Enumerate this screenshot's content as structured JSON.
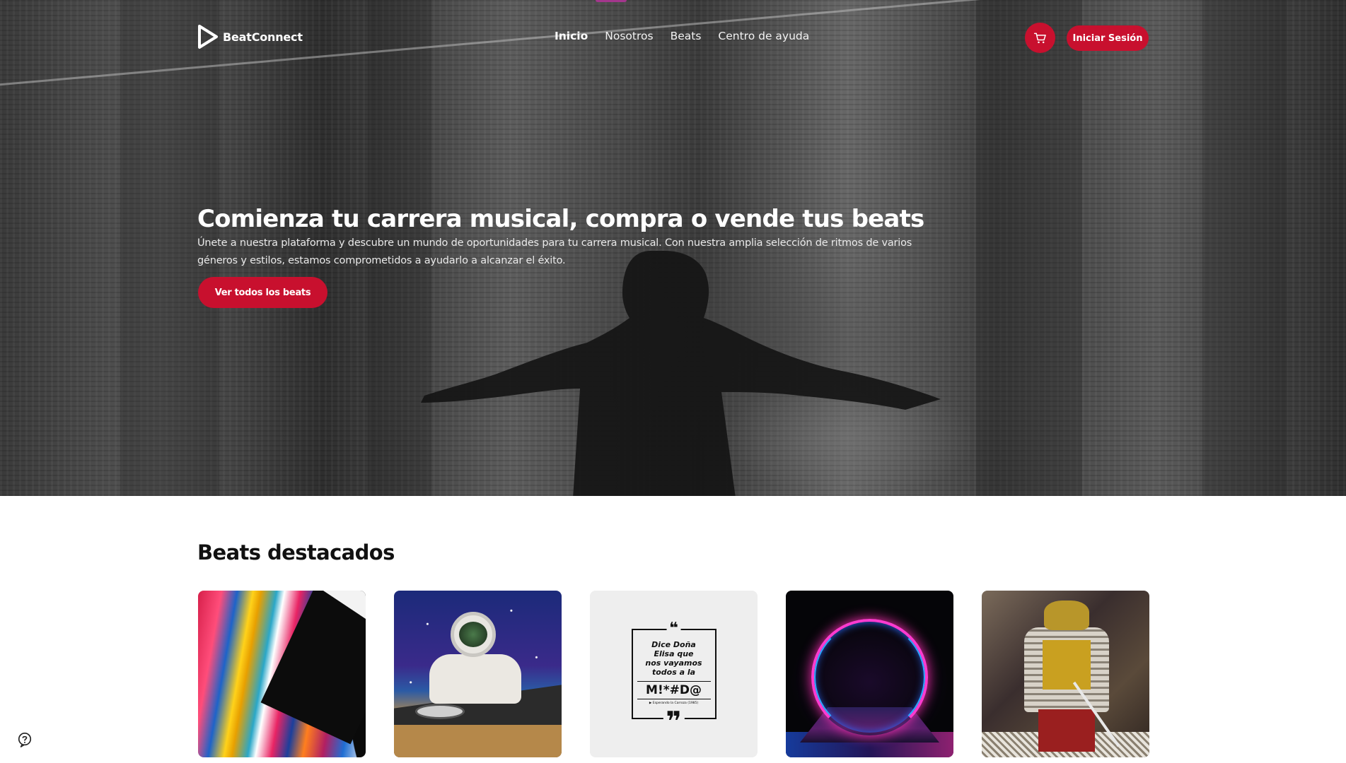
{
  "nav": {
    "logo_text": "BeatConnect",
    "menu": [
      {
        "label": "Inicio",
        "active": true
      },
      {
        "label": "Nosotros",
        "active": false
      },
      {
        "label": "Beats",
        "active": false
      },
      {
        "label": "Centro de ayuda",
        "active": false
      }
    ],
    "cart_icon": "cart-icon",
    "login_label": "Iniciar Sesión"
  },
  "hero": {
    "title_regular": "Comienza tu carrera musical,",
    "title_bold": "compra o vende tus beats",
    "description": "Únete a nuestra plataforma y descubre un mundo de oportunidades para tu carrera musical. Con nuestra amplia selección de ritmos de varios géneros y estilos, estamos comprometidos a ayudarlo a alcanzar el éxito.",
    "cta_label": "Ver todos los beats"
  },
  "featured": {
    "title_regular": "Beats",
    "title_bold": "destacados",
    "cards": [
      {
        "art": "paint-drip-artwork"
      },
      {
        "art": "astronaut-dj-artwork"
      },
      {
        "art": "quote-poster-artwork",
        "quote_lines": [
          "Dice Doña",
          "Elisa que",
          "nos vayamos",
          "todos a la"
        ],
        "quote_word": "M!*#D@",
        "quote_cite": "▶ Esperando la Carroza (1985)"
      },
      {
        "art": "neon-arch-artwork"
      },
      {
        "art": "samurai-painting-artwork"
      }
    ]
  },
  "colors": {
    "accent": "#c8102e",
    "hero_indicator": "#a3368c"
  },
  "help_icon": "help-circle-icon"
}
